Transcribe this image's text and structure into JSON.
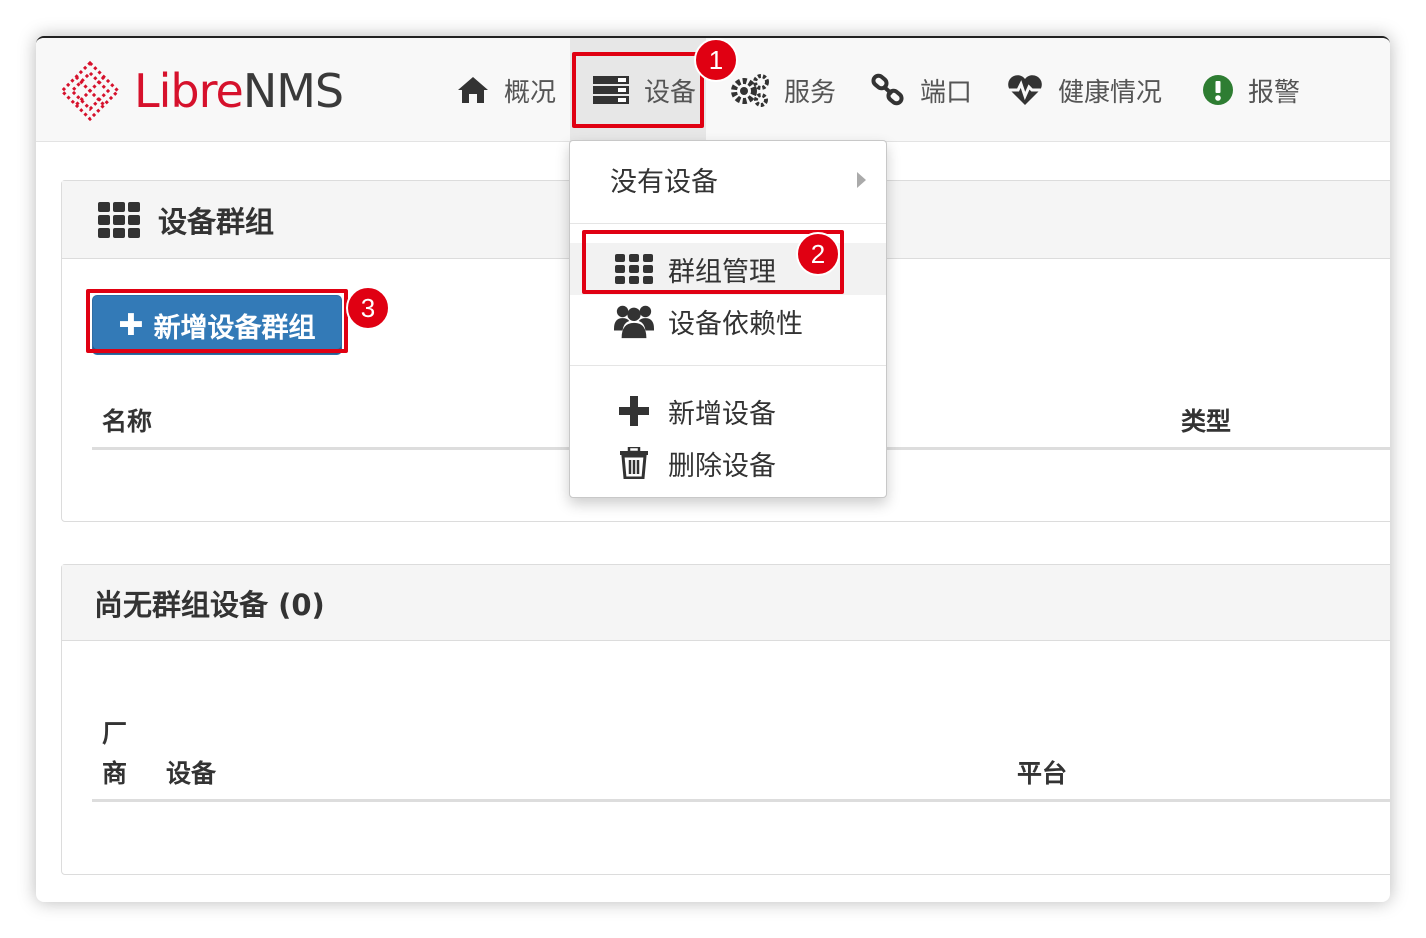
{
  "brand": {
    "libre": "Libre",
    "nms": "NMS"
  },
  "nav": {
    "items": [
      {
        "label": "概况",
        "icon": "home-icon"
      },
      {
        "label": "设备",
        "icon": "server-icon"
      },
      {
        "label": "服务",
        "icon": "cogs-icon"
      },
      {
        "label": "端口",
        "icon": "link-icon"
      },
      {
        "label": "健康情况",
        "icon": "heartbeat-icon"
      },
      {
        "label": "报警",
        "icon": "exclamation-circle-icon"
      }
    ],
    "active": "设备"
  },
  "dropdown": {
    "items": [
      {
        "label": "没有设备",
        "icon": "",
        "submenu": true
      },
      {
        "label": "群组管理",
        "icon": "th-icon",
        "highlighted": true
      },
      {
        "label": "设备依赖性",
        "icon": "users-icon"
      },
      {
        "label": "新增设备",
        "icon": "plus-icon"
      },
      {
        "label": "删除设备",
        "icon": "trash-icon"
      }
    ]
  },
  "groups_panel": {
    "title": "设备群组",
    "add_button": "新增设备群组",
    "columns": [
      "名称",
      "类型"
    ]
  },
  "ungrouped_panel": {
    "title": "尚无群组设备 (0)",
    "columns": [
      "厂商",
      "设备",
      "平台"
    ],
    "vendor_col_line1": "厂",
    "vendor_col_line2": "商"
  },
  "callouts": [
    "1",
    "2",
    "3"
  ],
  "colors": {
    "brand_red": "#d6112c",
    "primary_button": "#337ab7",
    "callout_red": "#e00012",
    "alert_green": "#2e7d32"
  }
}
